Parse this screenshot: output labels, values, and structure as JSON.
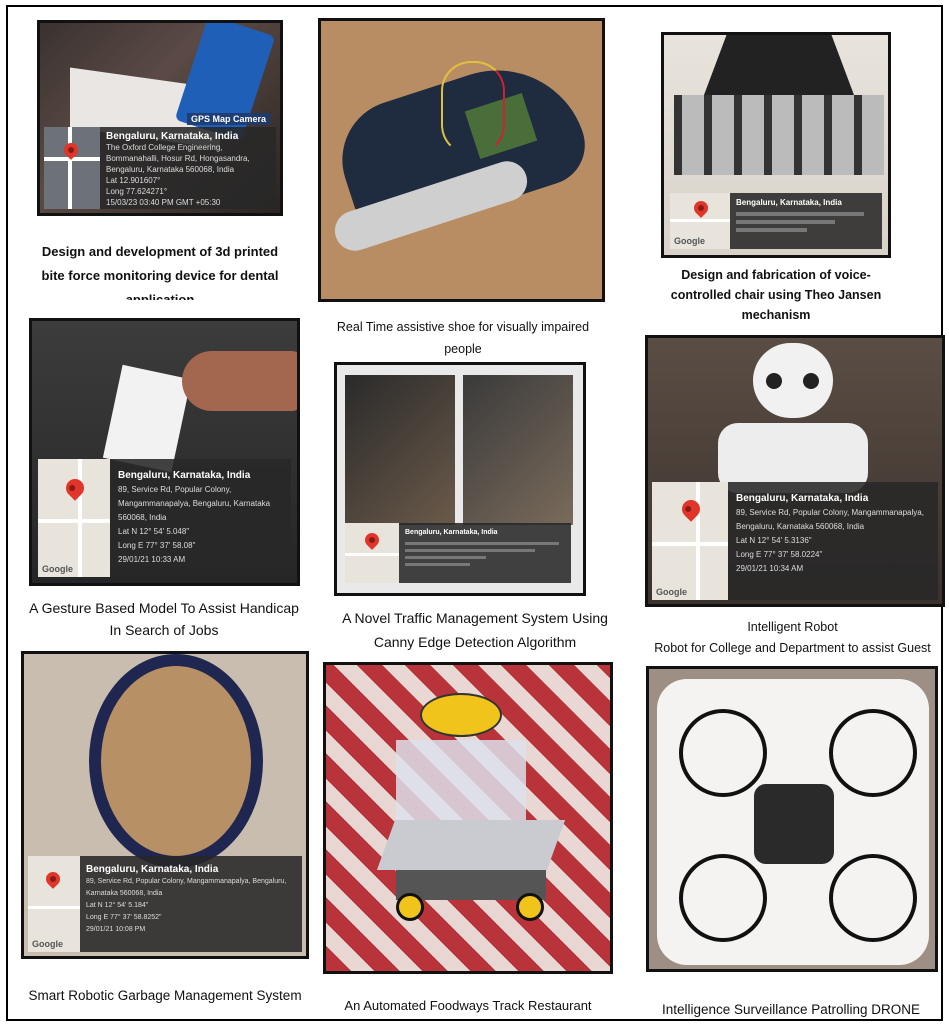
{
  "projects": [
    {
      "caption_lines": [
        "Design and development of 3d printed",
        "bite force monitoring device for dental",
        "application"
      ],
      "overlay": {
        "header": "GPS Map Camera",
        "location": "Bengaluru, Karnataka, India",
        "address": "The Oxford College Engineering, Bommanahalli, Hosur Rd, Hongasandra, Bengaluru, Karnataka 560068, India",
        "lat": "Lat 12.901607°",
        "long": "Long 77.624271°",
        "timestamp": "15/03/23 03:40 PM GMT +05:30"
      }
    },
    {
      "caption_lines": [
        "Real Time assistive shoe for visually impaired",
        "people"
      ]
    },
    {
      "caption_lines": [
        "Design and fabrication of voice-",
        "controlled chair using Theo Jansen",
        "mechanism"
      ],
      "overlay": {
        "location": "Bengaluru, Karnataka, India",
        "address": "",
        "lat": "",
        "long": "",
        "timestamp": ""
      }
    },
    {
      "caption_lines": [
        "A Gesture Based Model To Assist Handicap",
        "In Search of Jobs"
      ],
      "overlay": {
        "location": "Bengaluru, Karnataka, India",
        "address": "89, Service Rd, Popular Colony, Mangammanapalya, Bengaluru, Karnataka 560068, India",
        "lat": "Lat N 12° 54' 5.048\"",
        "long": "Long E 77° 37' 58.08\"",
        "timestamp": "29/01/21 10:33 AM"
      }
    },
    {
      "caption_lines": [
        "A Novel Traffic Management System Using",
        "Canny Edge Detection Algorithm"
      ],
      "overlay": {
        "location": "Bengaluru, Karnataka, India",
        "address": "",
        "lat": "",
        "long": "",
        "timestamp": ""
      }
    },
    {
      "caption_lines": [
        "Intelligent Robot",
        "Robot for College and Department to assist Guest"
      ],
      "overlay": {
        "location": "Bengaluru, Karnataka, India",
        "address": "89, Service Rd, Popular Colony, Mangammanapalya, Bengaluru, Karnataka 560068, India",
        "lat": "Lat N 12° 54' 5.3136\"",
        "long": "Long E 77° 37' 58.0224\"",
        "timestamp": "29/01/21 10:34 AM"
      }
    },
    {
      "caption_lines": [
        "Smart Robotic Garbage Management System"
      ],
      "overlay": {
        "location": "Bengaluru, Karnataka, India",
        "address": "89, Service Rd, Popular Colony, Mangammanapalya, Bengaluru, Karnataka 560068, India",
        "lat": "Lat N 12° 54' 5.184\"",
        "long": "Long E 77° 37' 58.8252\"",
        "timestamp": "29/01/21 10:08 PM"
      }
    },
    {
      "caption_lines": [
        "An Automated Foodways Track Restaurant"
      ]
    },
    {
      "caption_lines": [
        "Intelligence Surveillance Patrolling DRONE"
      ]
    }
  ],
  "map_logo": "Google",
  "colors": {
    "pin": "#e0352b",
    "overlay": "#2a2a2a",
    "frame": "#000000"
  }
}
